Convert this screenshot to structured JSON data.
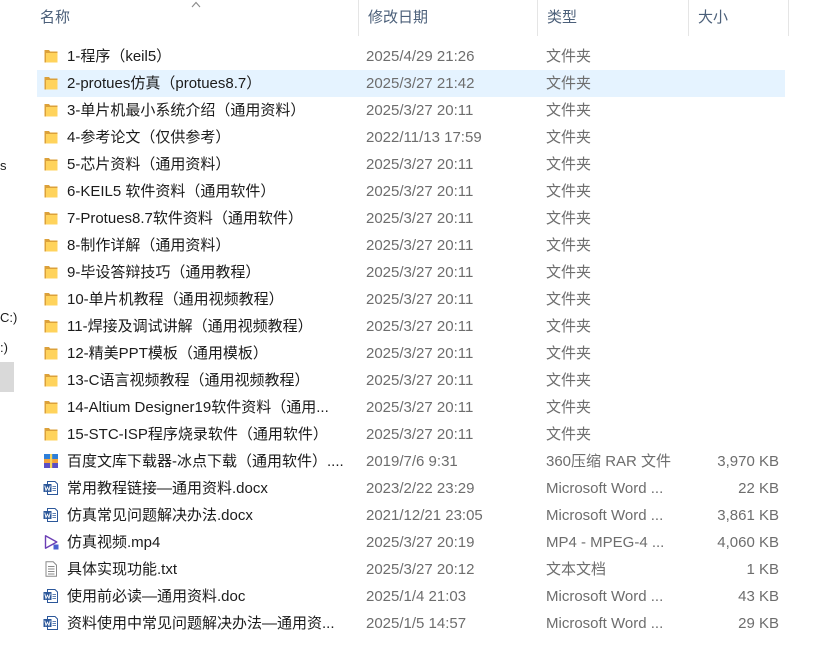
{
  "nav_pane": {
    "fragments": [
      "s",
      "C:)",
      ":)"
    ]
  },
  "header": {
    "columns": [
      {
        "label": "名称",
        "sorted": true
      },
      {
        "label": "修改日期"
      },
      {
        "label": "类型"
      },
      {
        "label": "大小"
      }
    ],
    "sort_icon": "chevron-up-icon"
  },
  "files": [
    {
      "name": "1-程序（keil5）",
      "modified": "2025/4/29 21:26",
      "type": "文件夹",
      "icon": "folder-icon"
    },
    {
      "name": "2-protues仿真（protues8.7）",
      "modified": "2025/3/27 21:42",
      "type": "文件夹",
      "icon": "folder-icon",
      "selected": true
    },
    {
      "name": "3-单片机最小系统介绍（通用资料）",
      "modified": "2025/3/27 20:11",
      "type": "文件夹",
      "icon": "folder-icon"
    },
    {
      "name": "4-参考论文（仅供参考）",
      "modified": "2022/11/13 17:59",
      "type": "文件夹",
      "icon": "folder-icon"
    },
    {
      "name": "5-芯片资料（通用资料）",
      "modified": "2025/3/27 20:11",
      "type": "文件夹",
      "icon": "folder-icon"
    },
    {
      "name": "6-KEIL5 软件资料（通用软件）",
      "modified": "2025/3/27 20:11",
      "type": "文件夹",
      "icon": "folder-icon"
    },
    {
      "name": "7-Protues8.7软件资料（通用软件）",
      "modified": "2025/3/27 20:11",
      "type": "文件夹",
      "icon": "folder-icon"
    },
    {
      "name": "8-制作详解（通用资料）",
      "modified": "2025/3/27 20:11",
      "type": "文件夹",
      "icon": "folder-icon"
    },
    {
      "name": "9-毕设答辩技巧（通用教程）",
      "modified": "2025/3/27 20:11",
      "type": "文件夹",
      "icon": "folder-icon"
    },
    {
      "name": "10-单片机教程（通用视频教程）",
      "modified": "2025/3/27 20:11",
      "type": "文件夹",
      "icon": "folder-icon"
    },
    {
      "name": "11-焊接及调试讲解（通用视频教程）",
      "modified": "2025/3/27 20:11",
      "type": "文件夹",
      "icon": "folder-icon"
    },
    {
      "name": "12-精美PPT模板（通用模板）",
      "modified": "2025/3/27 20:11",
      "type": "文件夹",
      "icon": "folder-icon"
    },
    {
      "name": "13-C语言视频教程（通用视频教程）",
      "modified": "2025/3/27 20:11",
      "type": "文件夹",
      "icon": "folder-icon"
    },
    {
      "name": "14-Altium Designer19软件资料（通用...",
      "modified": "2025/3/27 20:11",
      "type": "文件夹",
      "icon": "folder-icon"
    },
    {
      "name": "15-STC-ISP程序烧录软件（通用软件）",
      "modified": "2025/3/27 20:11",
      "type": "文件夹",
      "icon": "folder-icon"
    },
    {
      "name": "百度文库下载器-冰点下载（通用软件）....",
      "modified": "2019/7/6 9:31",
      "type": "360压缩 RAR 文件",
      "size": "3,970 KB",
      "icon": "rar-archive-icon"
    },
    {
      "name": "常用教程链接—通用资料.docx",
      "modified": "2023/2/22 23:29",
      "type": "Microsoft Word ...",
      "size": "22 KB",
      "icon": "word-document-icon"
    },
    {
      "name": "仿真常见问题解决办法.docx",
      "modified": "2021/12/21 23:05",
      "type": "Microsoft Word ...",
      "size": "3,861 KB",
      "icon": "word-document-icon"
    },
    {
      "name": "仿真视频.mp4",
      "modified": "2025/3/27 20:19",
      "type": "MP4 - MPEG-4 ...",
      "size": "4,060 KB",
      "icon": "video-file-icon"
    },
    {
      "name": "具体实现功能.txt",
      "modified": "2025/3/27 20:12",
      "type": "文本文档",
      "size": "1 KB",
      "icon": "text-file-icon"
    },
    {
      "name": "使用前必读—通用资料.doc",
      "modified": "2025/1/4 21:03",
      "type": "Microsoft Word ...",
      "size": "43 KB",
      "icon": "word-document-icon"
    },
    {
      "name": "资料使用中常见问题解决办法—通用资...",
      "modified": "2025/1/5 14:57",
      "type": "Microsoft Word ...",
      "size": "29 KB",
      "icon": "word-document-icon"
    }
  ],
  "colors": {
    "selection": "#e5f3ff",
    "header_text": "#4c607a",
    "detail_text": "#6d6d6d",
    "nav_selected": "#d9d9d9",
    "folder": "#ffd35c"
  }
}
